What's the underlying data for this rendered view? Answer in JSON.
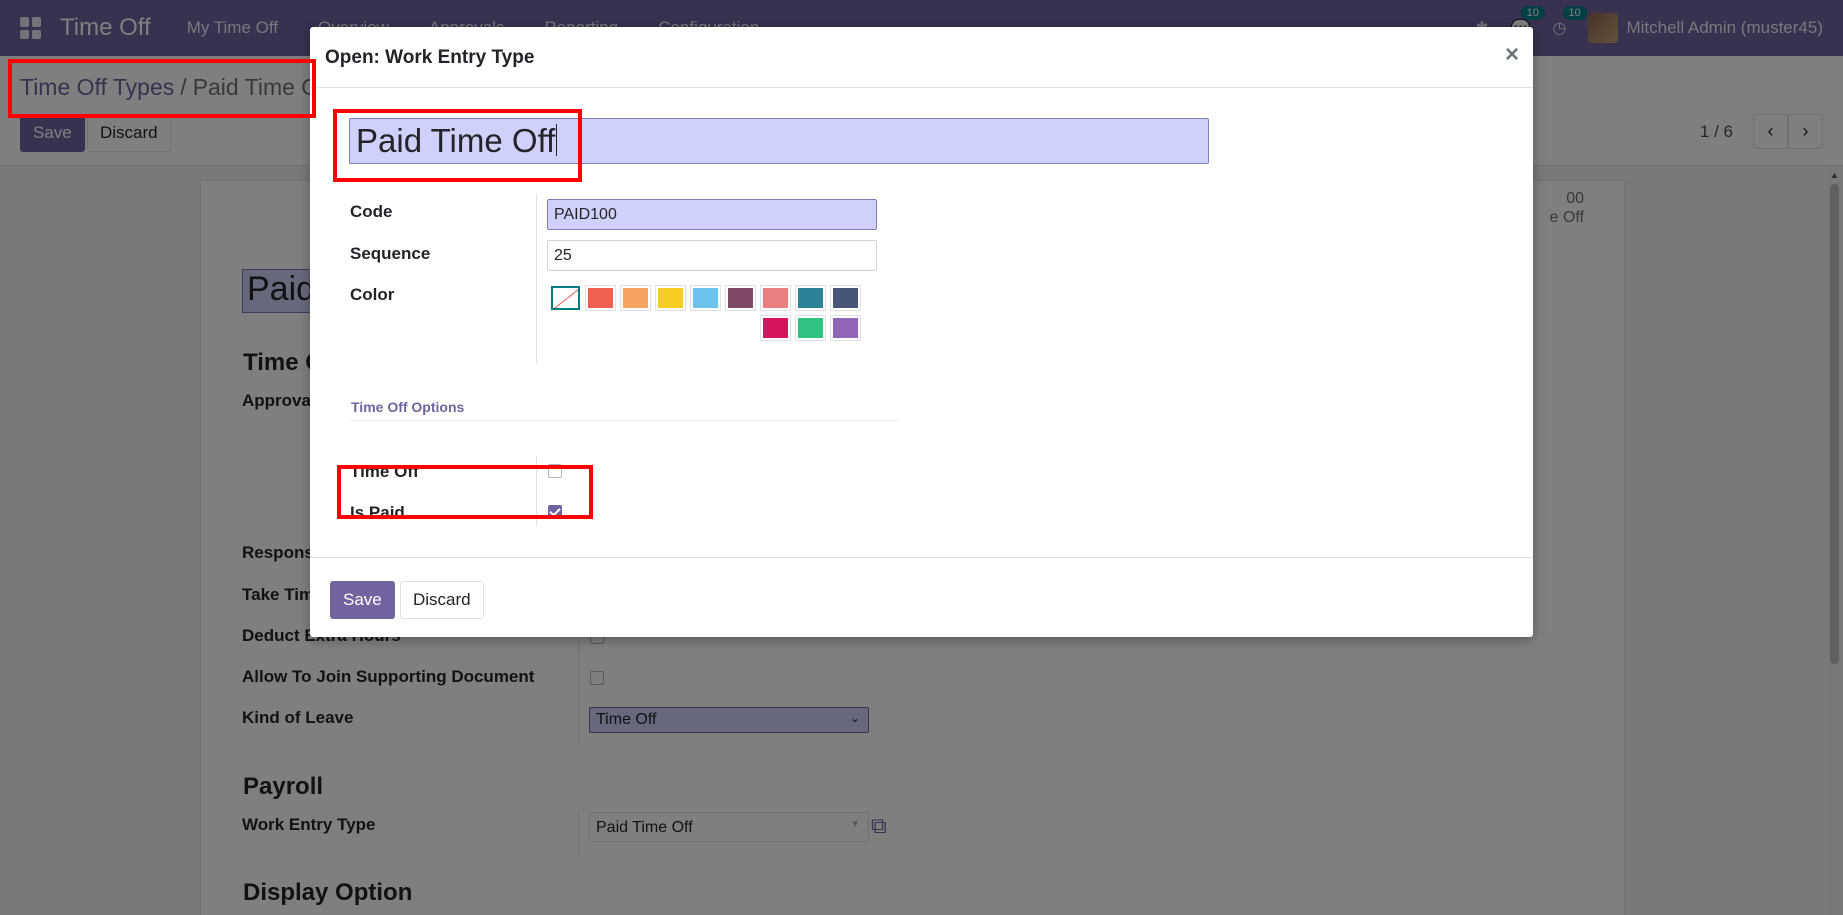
{
  "topnav": {
    "app_name": "Time Off",
    "menus": [
      "My Time Off",
      "Overview",
      "Approvals",
      "Reporting",
      "Configuration"
    ],
    "messages_count": "10",
    "activities_count": "10",
    "user": "Mitchell Admin (muster45)"
  },
  "control": {
    "breadcrumb_parent": "Time Off Types",
    "breadcrumb_sep": "/",
    "breadcrumb_current": "Paid Time Off",
    "save_label": "Save",
    "discard_label": "Discard",
    "pager": "1 / 6"
  },
  "sheet": {
    "name": "Paid",
    "stat_value": "00",
    "stat_label": "e Off",
    "section_timeoff": "Time O",
    "label_approval": "Approval",
    "label_responsible": "Respons",
    "label_take_time": "Take Tim",
    "label_deduct": "Deduct Extra Hours",
    "label_allow_doc": "Allow To Join Supporting Document",
    "label_kind": "Kind of Leave",
    "kind_value": "Time Off",
    "section_payroll": "Payroll",
    "label_work_entry": "Work Entry Type",
    "work_entry_value": "Paid Time Off",
    "section_display": "Display Option"
  },
  "modal": {
    "title": "Open: Work Entry Type",
    "close": "×",
    "name": "Paid Time Off",
    "code_label": "Code",
    "code_value": "PAID100",
    "sequence_label": "Sequence",
    "sequence_value": "25",
    "color_label": "Color",
    "colors": [
      "#f06050",
      "#f4a460",
      "#f7cd1f",
      "#6cc1ed",
      "#814968",
      "#eb7e7f",
      "#2c8397",
      "#475577",
      "#d6145f",
      "#30c381",
      "#9365b8"
    ],
    "options_title": "Time Off Options",
    "timeoff_label": "Time Off",
    "timeoff_checked": false,
    "ispaid_label": "Is Paid",
    "ispaid_checked": true,
    "save_label": "Save",
    "discard_label": "Discard"
  }
}
